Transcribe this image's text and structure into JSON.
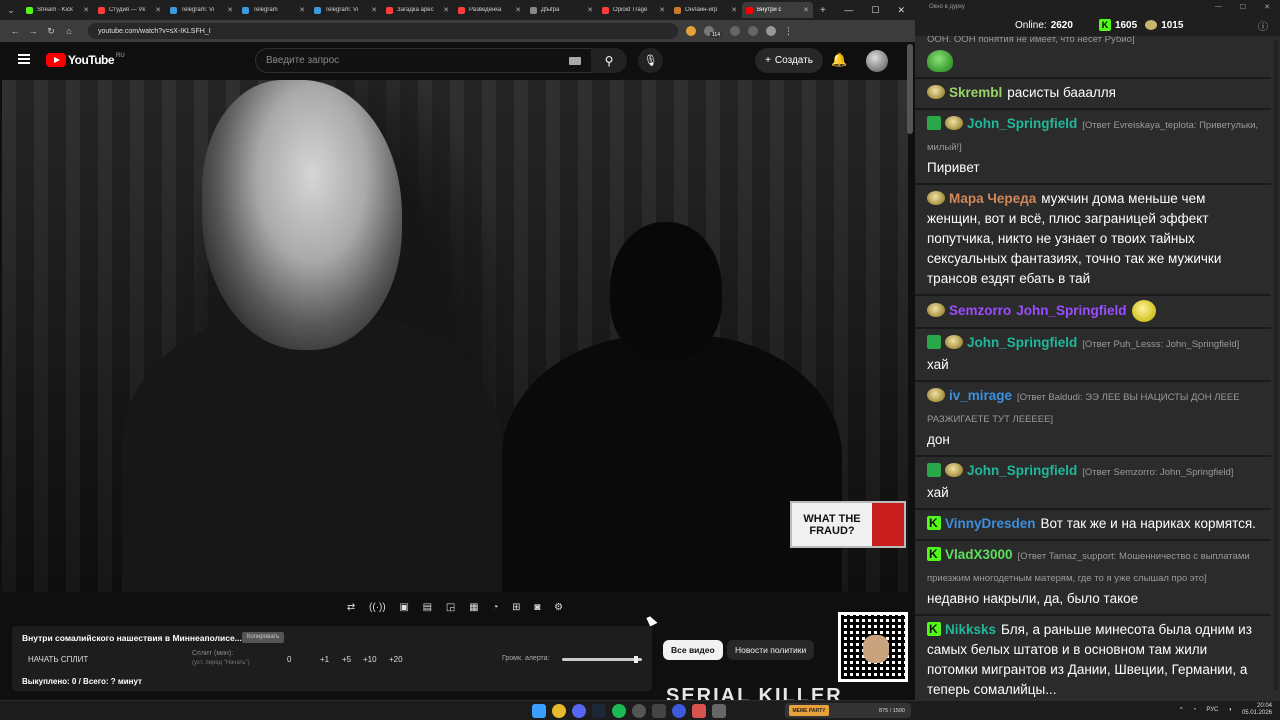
{
  "browser": {
    "tabs": [
      {
        "label": "Stream - Kick",
        "color": "#53fc18"
      },
      {
        "label": "Студия — Vk",
        "color": "#ff3b3b"
      },
      {
        "label": "Telegram: Vi",
        "color": "#3b9ae1"
      },
      {
        "label": "Telegram",
        "color": "#3b9ae1"
      },
      {
        "label": "Telegram: Vi",
        "color": "#3b9ae1"
      },
      {
        "label": "Загадка арес",
        "color": "#ff3b3b"
      },
      {
        "label": "Разведенка",
        "color": "#ff3b3b"
      },
      {
        "label": "Дfыfра",
        "color": "#888888"
      },
      {
        "label": "Opioid Trage",
        "color": "#ff3b3b"
      },
      {
        "label": "Онлайн-игр",
        "color": "#c97a2a"
      },
      {
        "label": "Внутри с",
        "color": "#ff0000",
        "active": true
      }
    ],
    "url": "youtube.com/watch?v=sX-IKLSFH_I",
    "ext_badge": "114"
  },
  "youtube": {
    "logo_text": "YouTube",
    "region": "RU",
    "search_placeholder": "Введите запрос",
    "create_label": "Создать",
    "video_overlay": {
      "line1": "WHAT THE",
      "line2": "FRAUD?"
    },
    "chips": [
      "Все видео",
      "Новости политики"
    ],
    "up_next_text": "SERIAL KILLER"
  },
  "split_panel": {
    "title": "Внутри сомалийского нашествия в Миннеаполисе...",
    "copy_label": "Копировать",
    "start_label": "НАЧАТЬ СПЛИТ",
    "split_label": "Сплит (мин):",
    "split_hint": "(уст. перед \"Начать\")",
    "split_value": "0",
    "steps": [
      "+1",
      "+5",
      "+10",
      "+20"
    ],
    "volume_label": "Громк. алерта:",
    "volume_level": 0.95,
    "bought_text": "Выкуплено: 0 / Всего: ? минут"
  },
  "chat": {
    "window_title": "Окно в дурку",
    "online_label": "Online:",
    "online_count": "2620",
    "followers": "1605",
    "subs": "1015",
    "messages": [
      {
        "top_partial": "ООН. ООН понятия не имеет, что несет Рубио]",
        "emote": "green"
      },
      {
        "badges": [
          "pepe"
        ],
        "nick": "Skrembl",
        "nick_color": "#9bd56a",
        "text": "расисты бааалля"
      },
      {
        "badges": [
          "mod",
          "pepe"
        ],
        "nick": "John_Springfield",
        "nick_color": "#1fb89b",
        "reply": "[Ответ Evreiskaya_teplota: Приветульки, милый!]",
        "text": "Пиривет"
      },
      {
        "badges": [
          "pepe"
        ],
        "nick": "Мара Череда",
        "nick_color": "#d0885a",
        "text": "мужчин дома меньше чем женщин, вот и всё, плюс заграницей эффект попутчика, никто не узнает о твоих тайных сексуальных фантазиях, точно так же мужички трансов ездят ебать в тай"
      },
      {
        "badges": [
          "pepe"
        ],
        "nick": "Semzorro",
        "nick_color": "#9b4dff",
        "text_mention": "John_Springfield",
        "mention_color": "#9b4dff",
        "emote": "yellow"
      },
      {
        "badges": [
          "mod",
          "pepe"
        ],
        "nick": "John_Springfield",
        "nick_color": "#1fb89b",
        "reply": "[Ответ Puh_Lesss: John_Springfield]",
        "text": "хай"
      },
      {
        "badges": [
          "pepe"
        ],
        "nick": "iv_mirage",
        "nick_color": "#3d8fe0",
        "reply": "[Ответ Baldudi: ЭЭ ЛЕЕ ВЫ НАЦИСТЫ ДОН ЛЕЕЕ РАЗЖИГАЕТЕ ТУТ ЛЕЕЕЕЕ]",
        "text": "дон"
      },
      {
        "badges": [
          "mod",
          "pepe"
        ],
        "nick": "John_Springfield",
        "nick_color": "#1fb89b",
        "reply": "[Ответ Semzorro: John_Springfield]",
        "text": "хай"
      },
      {
        "badges": [
          "kick"
        ],
        "nick": "VinnyDresden",
        "nick_color": "#3d8fe0",
        "text": "Вот так же и на нариках кормятся."
      },
      {
        "badges": [
          "kick"
        ],
        "nick": "VladX3000",
        "nick_color": "#5ce05c",
        "reply": "[Ответ Tamaz_support: Мошенничество с выплатами приезжим многодетным матерям, где то я уже слышал про это]",
        "text": "недавно накрыли, да, было такое"
      },
      {
        "badges": [
          "kick"
        ],
        "nick": "Nikksks",
        "nick_color": "#1fb89b",
        "text": "Бля, а раньше минесота была одним из самых белых штатов и в основном там жили потомки мигрантов из Дании, Швеции, Германии, а теперь сомалийцы..."
      }
    ]
  },
  "taskbar": {
    "media_tag": "МЕМЕ PARTY",
    "media_text": "875 / 1500",
    "lang": "РУС",
    "time": "20:04",
    "date": "05.01.2026"
  }
}
